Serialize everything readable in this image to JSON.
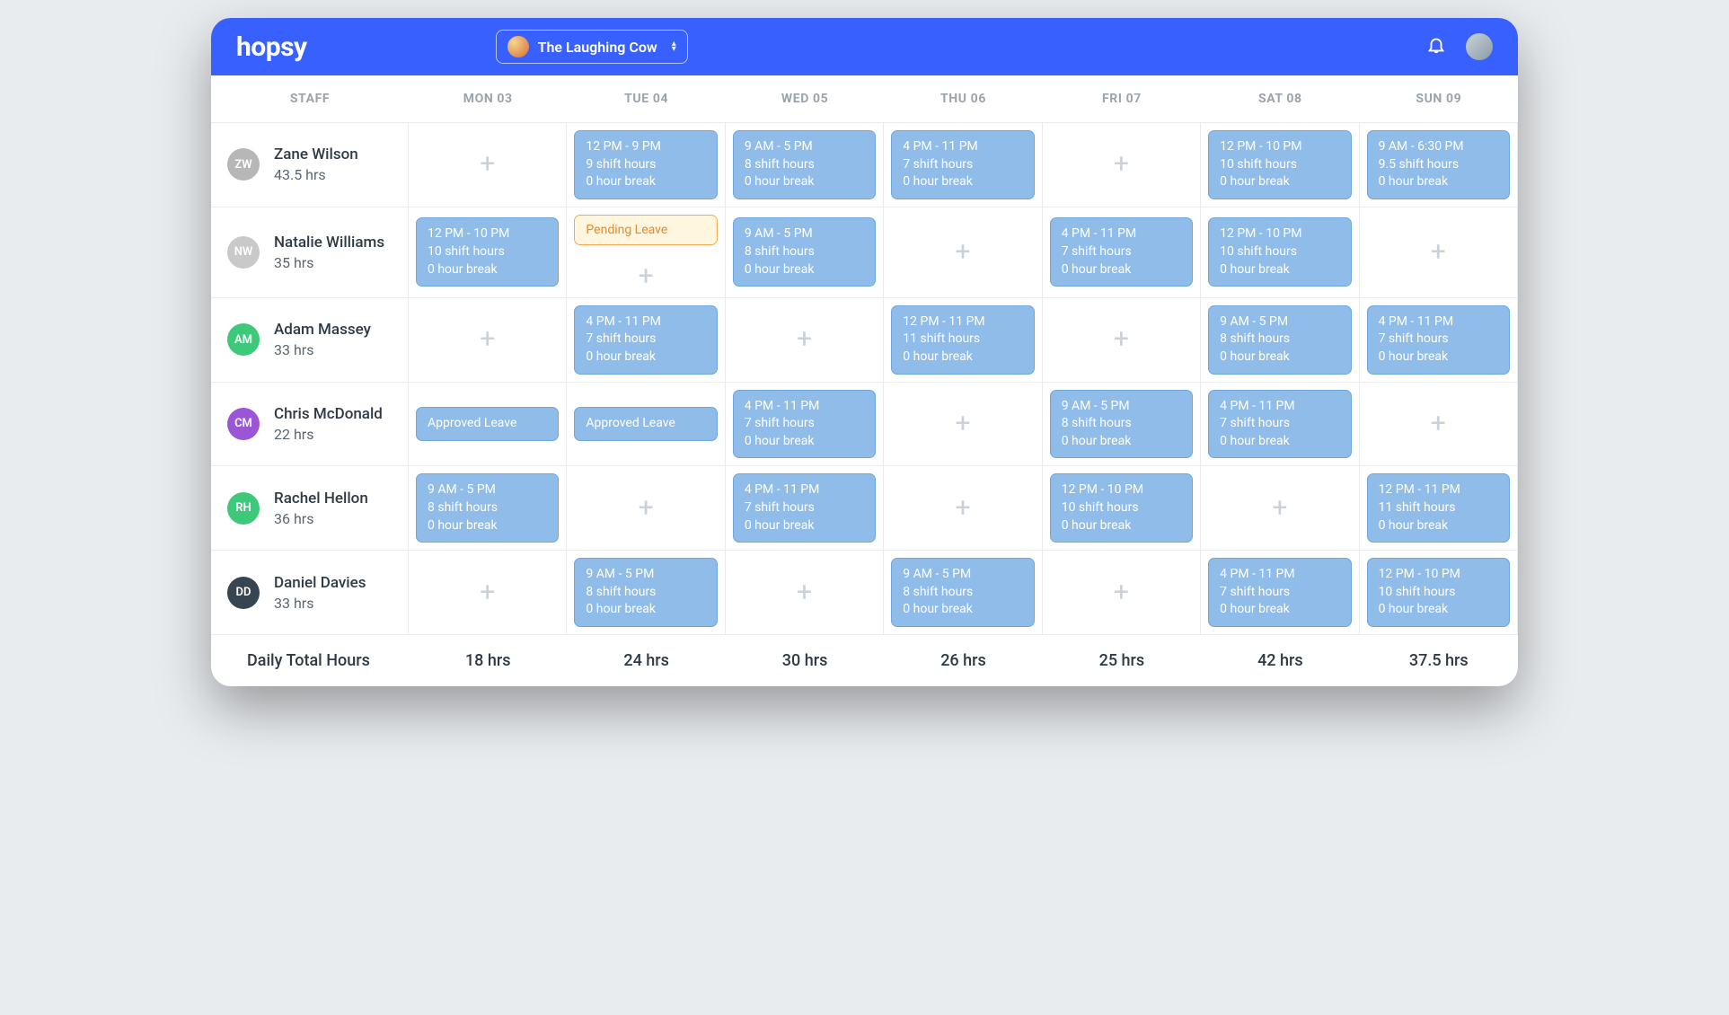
{
  "header": {
    "app_name": "hopsy",
    "venue_name": "The Laughing Cow"
  },
  "columns": {
    "staff_header": "STAFF",
    "days": [
      "MON 03",
      "TUE 04",
      "WED 05",
      "THU 06",
      "FRI 07",
      "SAT 08",
      "SUN 09"
    ]
  },
  "staff": [
    {
      "initials": "ZW",
      "avatar_color": "#b7b7b7",
      "name": "Zane Wilson",
      "hours": "43.5 hrs",
      "cells": [
        {
          "type": "empty"
        },
        {
          "type": "shift",
          "time": "12 PM - 9 PM",
          "shift_hours": "9 shift hours",
          "break": "0 hour break"
        },
        {
          "type": "shift",
          "time": "9 AM - 5 PM",
          "shift_hours": "8 shift hours",
          "break": "0 hour break"
        },
        {
          "type": "shift",
          "time": "4 PM - 11 PM",
          "shift_hours": "7 shift hours",
          "break": "0 hour break"
        },
        {
          "type": "empty"
        },
        {
          "type": "shift",
          "time": "12 PM - 10 PM",
          "shift_hours": "10 shift hours",
          "break": "0 hour break"
        },
        {
          "type": "shift",
          "time": "9 AM - 6:30 PM",
          "shift_hours": "9.5 shift hours",
          "break": "0 hour break"
        }
      ]
    },
    {
      "initials": "NW",
      "avatar_color": "#c9c9c9",
      "name": "Natalie Williams",
      "hours": "35 hrs",
      "cells": [
        {
          "type": "shift",
          "time": "12 PM - 10 PM",
          "shift_hours": "10 shift hours",
          "break": "0 hour break"
        },
        {
          "type": "pending",
          "label": "Pending Leave",
          "with_add": true
        },
        {
          "type": "shift",
          "time": "9 AM - 5 PM",
          "shift_hours": "8 shift hours",
          "break": "0 hour break"
        },
        {
          "type": "empty"
        },
        {
          "type": "shift",
          "time": "4 PM - 11 PM",
          "shift_hours": "7 shift hours",
          "break": "0 hour break"
        },
        {
          "type": "shift",
          "time": "12 PM - 10 PM",
          "shift_hours": "10 shift hours",
          "break": "0 hour break"
        },
        {
          "type": "empty"
        }
      ]
    },
    {
      "initials": "AM",
      "avatar_color": "#3ec97a",
      "name": "Adam Massey",
      "hours": "33 hrs",
      "cells": [
        {
          "type": "empty"
        },
        {
          "type": "shift",
          "time": "4 PM - 11 PM",
          "shift_hours": "7 shift hours",
          "break": "0 hour break"
        },
        {
          "type": "empty"
        },
        {
          "type": "shift",
          "time": "12 PM - 11 PM",
          "shift_hours": "11 shift hours",
          "break": "0 hour break"
        },
        {
          "type": "empty"
        },
        {
          "type": "shift",
          "time": "9 AM - 5 PM",
          "shift_hours": "8 shift hours",
          "break": "0 hour break"
        },
        {
          "type": "shift",
          "time": "4 PM - 11 PM",
          "shift_hours": "7 shift hours",
          "break": "0 hour break"
        }
      ]
    },
    {
      "initials": "CM",
      "avatar_color": "#9b55d6",
      "name": "Chris McDonald",
      "hours": "22 hrs",
      "cells": [
        {
          "type": "approved",
          "label": "Approved Leave"
        },
        {
          "type": "approved",
          "label": "Approved Leave"
        },
        {
          "type": "shift",
          "time": "4 PM - 11 PM",
          "shift_hours": "7 shift hours",
          "break": "0 hour break"
        },
        {
          "type": "empty"
        },
        {
          "type": "shift",
          "time": "9 AM - 5 PM",
          "shift_hours": "8 shift hours",
          "break": "0 hour break"
        },
        {
          "type": "shift",
          "time": "4 PM - 11 PM",
          "shift_hours": "7 shift hours",
          "break": "0 hour break"
        },
        {
          "type": "empty"
        }
      ]
    },
    {
      "initials": "RH",
      "avatar_color": "#3ec97a",
      "name": "Rachel Hellon",
      "hours": "36 hrs",
      "cells": [
        {
          "type": "shift",
          "time": "9 AM - 5 PM",
          "shift_hours": "8 shift hours",
          "break": "0 hour break"
        },
        {
          "type": "empty"
        },
        {
          "type": "shift",
          "time": "4 PM - 11 PM",
          "shift_hours": "7 shift hours",
          "break": "0 hour break"
        },
        {
          "type": "empty"
        },
        {
          "type": "shift",
          "time": "12 PM - 10 PM",
          "shift_hours": "10 shift hours",
          "break": "0 hour break"
        },
        {
          "type": "empty"
        },
        {
          "type": "shift",
          "time": "12 PM - 11 PM",
          "shift_hours": "11 shift hours",
          "break": "0 hour break"
        }
      ]
    },
    {
      "initials": "DD",
      "avatar_color": "#374452",
      "name": "Daniel Davies",
      "hours": "33 hrs",
      "cells": [
        {
          "type": "empty"
        },
        {
          "type": "shift",
          "time": "9 AM - 5 PM",
          "shift_hours": "8 shift hours",
          "break": "0 hour break"
        },
        {
          "type": "empty"
        },
        {
          "type": "shift",
          "time": "9 AM - 5 PM",
          "shift_hours": "8 shift hours",
          "break": "0 hour break"
        },
        {
          "type": "empty"
        },
        {
          "type": "shift",
          "time": "4 PM - 11 PM",
          "shift_hours": "7 shift hours",
          "break": "0 hour break"
        },
        {
          "type": "shift",
          "time": "12 PM - 10 PM",
          "shift_hours": "10 shift hours",
          "break": "0 hour break"
        }
      ]
    }
  ],
  "footer": {
    "label": "Daily Total Hours",
    "totals": [
      "18 hrs",
      "24 hrs",
      "30 hrs",
      "26 hrs",
      "25 hrs",
      "42 hrs",
      "37.5 hrs"
    ]
  }
}
